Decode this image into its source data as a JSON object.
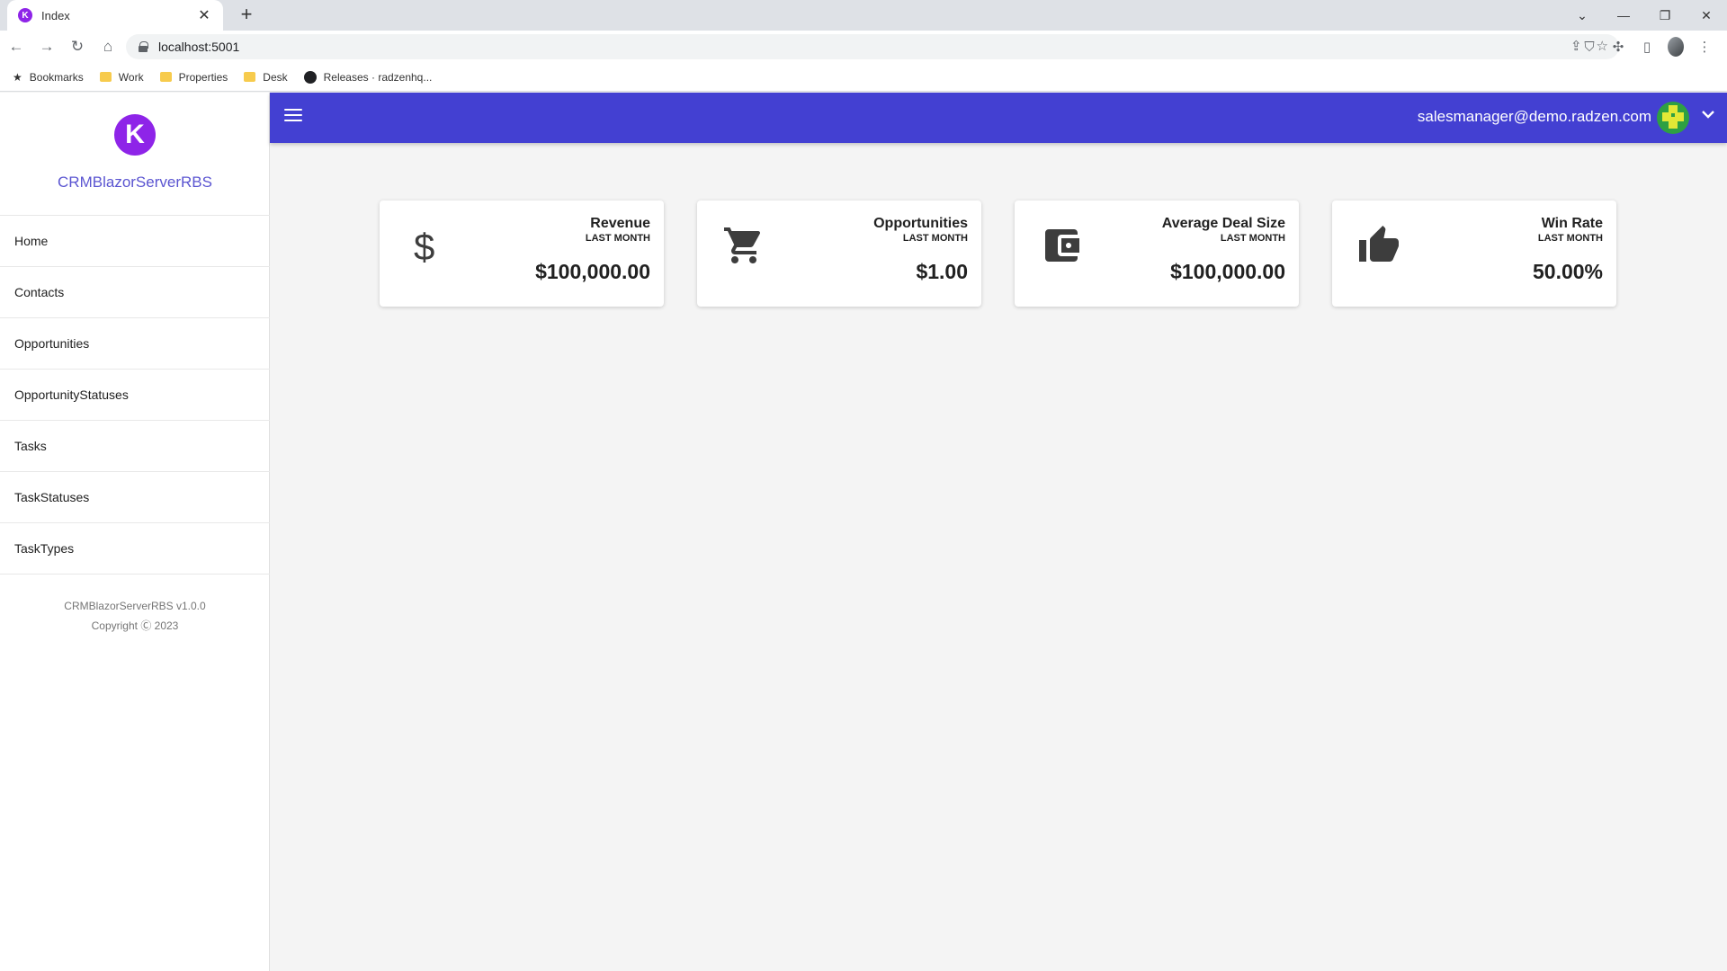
{
  "browser": {
    "tab_title": "Index",
    "tab_favicon": "K",
    "url": "localhost:5001",
    "bookmarks": [
      {
        "label": "Bookmarks",
        "icon": "star-icon"
      },
      {
        "label": "Work",
        "icon": "folder-icon"
      },
      {
        "label": "Properties",
        "icon": "folder-icon"
      },
      {
        "label": "Desk",
        "icon": "folder-icon"
      },
      {
        "label": "Releases · radzenhq...",
        "icon": "github-icon"
      }
    ]
  },
  "header": {
    "user_email": "salesmanager@demo.radzen.com"
  },
  "sidebar": {
    "logo_letter": "K",
    "app_name": "CRMBlazorServerRBS",
    "items": [
      {
        "label": "Home"
      },
      {
        "label": "Contacts"
      },
      {
        "label": "Opportunities"
      },
      {
        "label": "OpportunityStatuses"
      },
      {
        "label": "Tasks"
      },
      {
        "label": "TaskStatuses"
      },
      {
        "label": "TaskTypes"
      }
    ],
    "footer_version": "CRMBlazorServerRBS v1.0.0",
    "footer_copyright": "Copyright Ⓒ 2023"
  },
  "cards": [
    {
      "title": "Revenue",
      "subtitle": "LAST MONTH",
      "value": "$100,000.00",
      "icon": "dollar-icon"
    },
    {
      "title": "Opportunities",
      "subtitle": "LAST MONTH",
      "value": "$1.00",
      "icon": "cart-icon"
    },
    {
      "title": "Average Deal Size",
      "subtitle": "LAST MONTH",
      "value": "$100,000.00",
      "icon": "wallet-icon"
    },
    {
      "title": "Win Rate",
      "subtitle": "LAST MONTH",
      "value": "50.00%",
      "icon": "thumbs-up-icon"
    }
  ],
  "colors": {
    "header_bg": "#4340d2",
    "accent": "#5b55d1",
    "logo_bg": "#8e24e8",
    "page_bg": "#f4f4f4",
    "icon_color": "#3d3d3d"
  }
}
